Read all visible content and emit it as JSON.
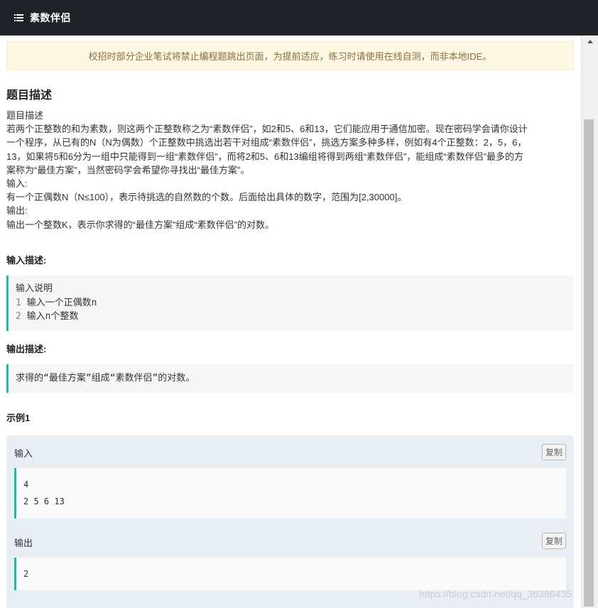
{
  "header": {
    "title": "素数伴侣",
    "icon": "list-icon"
  },
  "notice": {
    "text": "校招时部分企业笔试将禁止编程题跳出页面，为提前适应，练习时请使用在线自测，而非本地IDE。"
  },
  "problem": {
    "section_title": "题目描述",
    "lines": [
      "题目描述",
      "若两个正整数的和为素数，则这两个正整数称之为“素数伴侣”，如2和5、6和13，它们能应用于通信加密。现在密码学会请你设计",
      "一个程序，从已有的N（N为偶数）个正整数中挑选出若干对组成“素数伴侣”，挑选方案多种多样，例如有4个正整数：2，5，6，",
      "13，如果将5和6分为一组中只能得到一组“素数伴侣”，而将2和5、6和13编组将得到两组“素数伴侣”，能组成“素数伴侣”最多的方",
      "案称为“最佳方案”，当然密码学会希望你寻找出“最佳方案”。",
      "输入:",
      "有一个正偶数N（N≤100），表示待挑选的自然数的个数。后面给出具体的数字，范围为[2,30000]。",
      "输出:",
      "输出一个整数K，表示你求得的“最佳方案”组成“素数伴侣”的对数。"
    ]
  },
  "input_desc": {
    "title": "输入描述:",
    "header_line": "输入说明",
    "lines": [
      {
        "num": "1",
        "text": " 输入一个正偶数n"
      },
      {
        "num": "2",
        "text": " 输入n个整数"
      }
    ]
  },
  "output_desc": {
    "title": "输出描述:",
    "text": "求得的“最佳方案”组成“素数伴侣”的对数。"
  },
  "example": {
    "title": "示例1",
    "input_label": "输入",
    "input_lines": [
      "4",
      "2 5 6 13"
    ],
    "output_label": "输出",
    "output_lines": [
      "2"
    ],
    "copy_label": "复制"
  },
  "watermark": "https://blog.csdn.net/qq_36386435",
  "colors": {
    "topbar": "#1f2328",
    "accent": "#1abc9c",
    "notice_bg": "#fcf8e3",
    "notice_text": "#8a6d3b",
    "panel_bg": "#e9eef5"
  }
}
